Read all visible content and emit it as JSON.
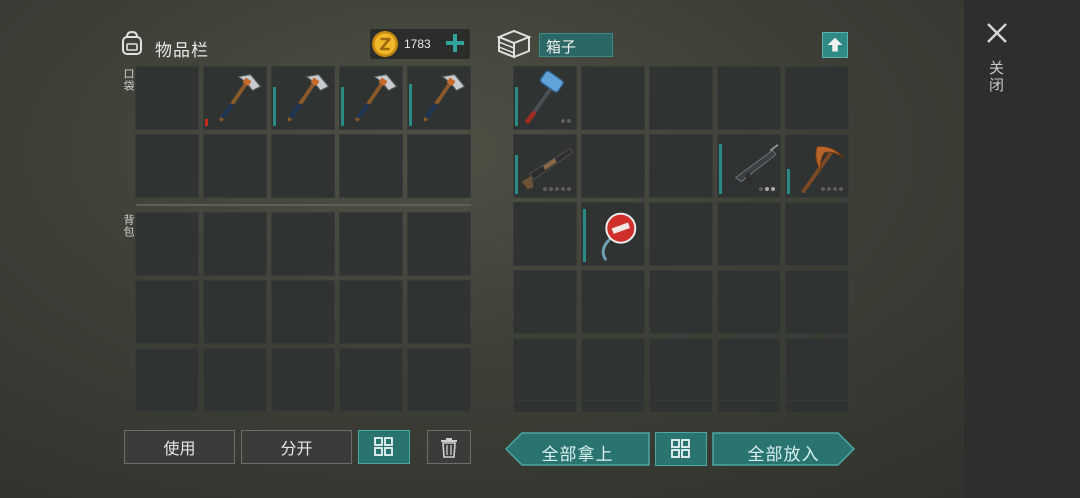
{
  "inventory": {
    "title": "物品栏",
    "coins": "1783",
    "pocket_label": "口袋",
    "backpack_label": "背包",
    "pocket_slots": [
      {
        "item": null,
        "durability": null
      },
      {
        "item": "hatchet",
        "durability": 0.12,
        "durability_color": "#c42a21"
      },
      {
        "item": "hatchet",
        "durability": 0.7
      },
      {
        "item": "hatchet",
        "durability": 0.7
      },
      {
        "item": "hatchet",
        "durability": 0.75
      },
      {
        "item": null
      },
      {
        "item": null
      },
      {
        "item": null
      },
      {
        "item": null
      },
      {
        "item": null
      }
    ],
    "backpack_rows": 3,
    "backpack_cols": 5
  },
  "container": {
    "name": "箱子",
    "slots": [
      {
        "item": "sledgehammer",
        "durability": 0.7,
        "dots": 2,
        "dots_on": 0
      },
      {
        "item": null
      },
      {
        "item": null
      },
      {
        "item": null
      },
      {
        "item": null
      },
      {
        "item": "shotgun",
        "durability": 0.7,
        "dots": 5,
        "dots_on": 0
      },
      {
        "item": null
      },
      {
        "item": null
      },
      {
        "item": "assault-rifle",
        "durability": 0.9,
        "dots": 3,
        "dots_on": 2
      },
      {
        "item": "pickaxe",
        "durability": 0.45,
        "dots": 4,
        "dots_on": 0
      },
      {
        "item": null
      },
      {
        "item": "lollipop",
        "durability": 0.95
      },
      {
        "item": null
      },
      {
        "item": null
      },
      {
        "item": null
      },
      {
        "item": null
      },
      {
        "item": null
      },
      {
        "item": null
      },
      {
        "item": null
      },
      {
        "item": null
      },
      {
        "item": null
      },
      {
        "item": null
      },
      {
        "item": null
      },
      {
        "item": null
      },
      {
        "item": null
      }
    ]
  },
  "buttons": {
    "use": "使用",
    "split": "分开",
    "take_all": "全部拿上",
    "put_all": "全部放入",
    "close": "关闭"
  },
  "colors": {
    "accent_teal": "#2a7470",
    "durability_teal": "#2a8a86",
    "durability_low": "#c42a21",
    "coin_gold": "#e3a51c"
  },
  "icons": {
    "bag": "backpack-icon",
    "coin": "coin-icon",
    "add": "plus-icon",
    "box": "crate-icon",
    "upload": "arrow-up-icon",
    "sort": "sort-grid-icon",
    "trash": "trash-icon",
    "close": "close-icon"
  }
}
